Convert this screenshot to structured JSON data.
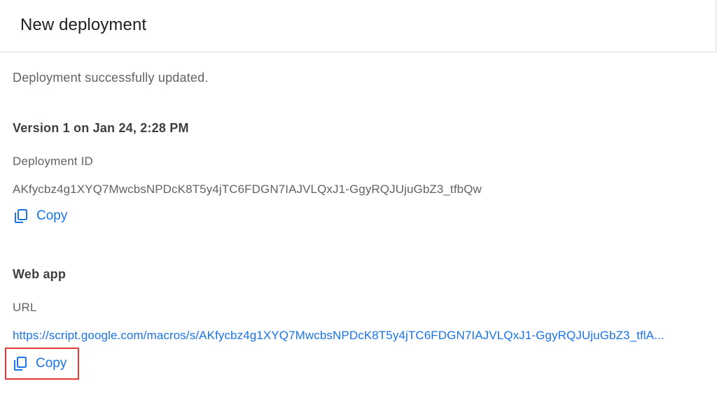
{
  "dialog": {
    "title": "New deployment",
    "status": "Deployment successfully updated.",
    "version_heading": "Version 1 on Jan 24, 2:28 PM",
    "deployment_id": {
      "label": "Deployment ID",
      "value": "AKfycbz4g1XYQ7MwcbsNPDcK8T5y4jTC6FDGN7IAJVLQxJ1-GgyRQJUjuGbZ3_tfbQw",
      "copy_label": "Copy"
    },
    "web_app": {
      "heading": "Web app",
      "url_label": "URL",
      "url_value": "https://script.google.com/macros/s/AKfycbz4g1XYQ7MwcbsNPDcK8T5y4jTC6FDGN7IAJVLQxJ1-GgyRQJUjuGbZ3_tflA...",
      "copy_label": "Copy"
    }
  },
  "colors": {
    "accent": "#1a73e8",
    "highlight_border": "#e53935",
    "text_primary": "#202124",
    "text_secondary": "#5f6368"
  },
  "icons": {
    "copy": "copy-icon"
  }
}
